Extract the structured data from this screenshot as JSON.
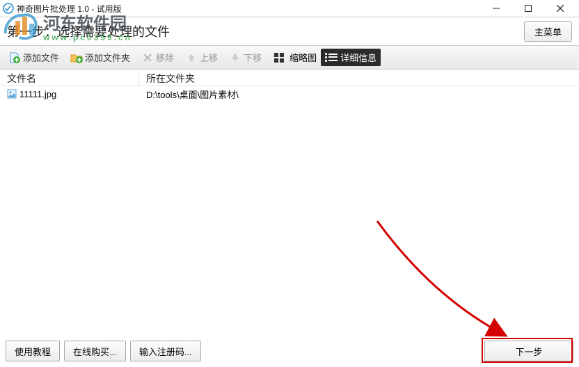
{
  "window": {
    "title": "神奇图片批处理 1.0 - 试用版"
  },
  "header": {
    "step_text": "第一步：选择需要处理的文件",
    "main_menu": "主菜单"
  },
  "toolbar": {
    "add_file": "添加文件",
    "add_folder": "添加文件夹",
    "remove": "移除",
    "move_up": "上移",
    "move_down": "下移",
    "thumbnail": "缩略图",
    "detail": "详细信息"
  },
  "table": {
    "col_filename": "文件名",
    "col_folder": "所在文件夹",
    "rows": [
      {
        "filename": "11111.jpg",
        "folder": "D:\\tools\\桌面\\图片素材\\"
      }
    ]
  },
  "bottom": {
    "tutorial": "使用教程",
    "buy_online": "在线购买...",
    "enter_code": "输入注册码...",
    "next": "下一步"
  },
  "watermark": {
    "text": "河东软件园",
    "domain": "www.pc0359.cn"
  }
}
